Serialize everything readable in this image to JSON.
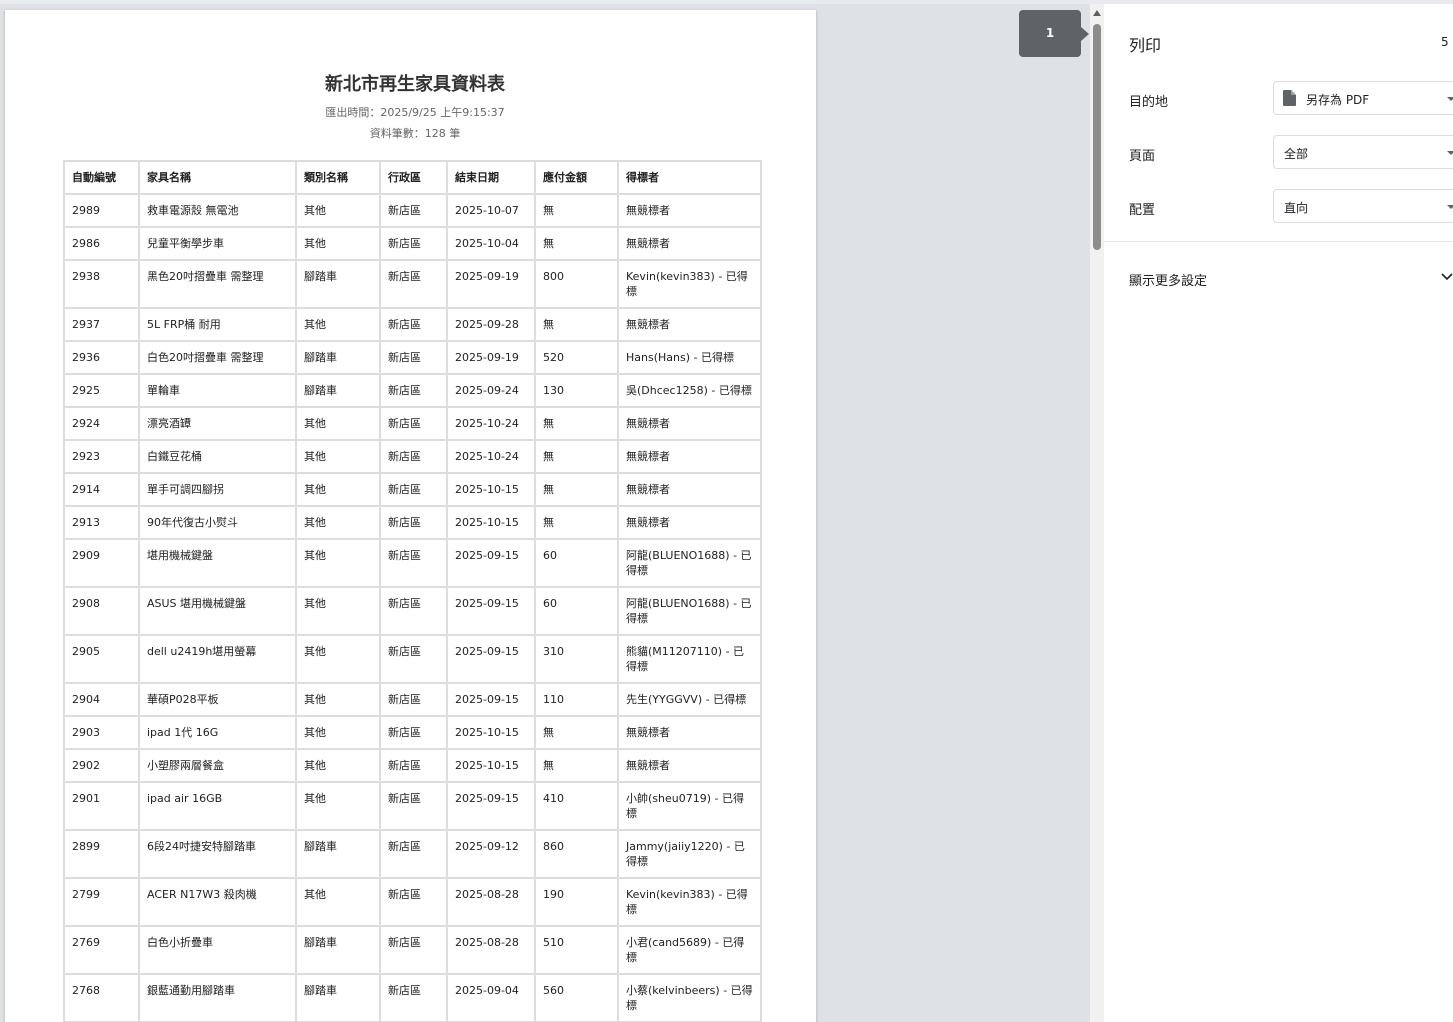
{
  "document": {
    "title": "新北市再生家具資料表",
    "export_time": "匯出時間：2025/9/25 上午9:15:37",
    "record_count": "資料筆數：128 筆"
  },
  "table": {
    "headers": [
      "自動編號",
      "家具名稱",
      "類別名稱",
      "行政區",
      "結束日期",
      "應付金額",
      "得標者"
    ],
    "rows": [
      [
        "2989",
        "救車電源殼 無電池",
        "其他",
        "新店區",
        "2025-10-07",
        "無",
        "無競標者"
      ],
      [
        "2986",
        "兒童平衡學步車",
        "其他",
        "新店區",
        "2025-10-04",
        "無",
        "無競標者"
      ],
      [
        "2938",
        "黑色20吋摺疊車 需整理",
        "腳踏車",
        "新店區",
        "2025-09-19",
        "800",
        "Kevin(kevin383) - 已得標"
      ],
      [
        "2937",
        "5L FRP桶 耐用",
        "其他",
        "新店區",
        "2025-09-28",
        "無",
        "無競標者"
      ],
      [
        "2936",
        "白色20吋摺疊車 需整理",
        "腳踏車",
        "新店區",
        "2025-09-19",
        "520",
        "Hans(Hans) - 已得標"
      ],
      [
        "2925",
        "單輪車",
        "腳踏車",
        "新店區",
        "2025-09-24",
        "130",
        "吳(Dhcec1258) - 已得標"
      ],
      [
        "2924",
        "漂亮酒罈",
        "其他",
        "新店區",
        "2025-10-24",
        "無",
        "無競標者"
      ],
      [
        "2923",
        "白鐵豆花桶",
        "其他",
        "新店區",
        "2025-10-24",
        "無",
        "無競標者"
      ],
      [
        "2914",
        "單手可調四腳拐",
        "其他",
        "新店區",
        "2025-10-15",
        "無",
        "無競標者"
      ],
      [
        "2913",
        "90年代復古小熨斗",
        "其他",
        "新店區",
        "2025-10-15",
        "無",
        "無競標者"
      ],
      [
        "2909",
        "堪用機械鍵盤",
        "其他",
        "新店區",
        "2025-09-15",
        "60",
        "阿龍(BLUENO1688) - 已得標"
      ],
      [
        "2908",
        "ASUS 堪用機械鍵盤",
        "其他",
        "新店區",
        "2025-09-15",
        "60",
        "阿龍(BLUENO1688) - 已得標"
      ],
      [
        "2905",
        "dell u2419h堪用螢幕",
        "其他",
        "新店區",
        "2025-09-15",
        "310",
        "熊貓(M11207110) - 已得標"
      ],
      [
        "2904",
        "華碩P028平板",
        "其他",
        "新店區",
        "2025-09-15",
        "110",
        "先生(YYGGVV) - 已得標"
      ],
      [
        "2903",
        "ipad 1代 16G",
        "其他",
        "新店區",
        "2025-10-15",
        "無",
        "無競標者"
      ],
      [
        "2902",
        "小塑膠兩層餐盒",
        "其他",
        "新店區",
        "2025-10-15",
        "無",
        "無競標者"
      ],
      [
        "2901",
        "ipad air 16GB",
        "其他",
        "新店區",
        "2025-09-15",
        "410",
        "小帥(sheu0719) - 已得標"
      ],
      [
        "2899",
        "6段24吋捷安特腳踏車",
        "腳踏車",
        "新店區",
        "2025-09-12",
        "860",
        "Jammy(jaiiy1220) - 已得標"
      ],
      [
        "2799",
        "ACER N17W3 殺肉機",
        "其他",
        "新店區",
        "2025-08-28",
        "190",
        "Kevin(kevin383) - 已得標"
      ],
      [
        "2769",
        "白色小折疊車",
        "腳踏車",
        "新店區",
        "2025-08-28",
        "510",
        "小君(cand5689) - 已得標"
      ],
      [
        "2768",
        "銀藍通勤用腳踏車",
        "腳踏車",
        "新店區",
        "2025-09-04",
        "560",
        "小蔡(kelvinbeers) - 已得標"
      ]
    ]
  },
  "preview": {
    "page_number": "1"
  },
  "sidebar": {
    "title": "列印",
    "sheet_count": "5",
    "destination_label": "目的地",
    "destination_value": "另存為 PDF",
    "pages_label": "頁面",
    "pages_value": "全部",
    "layout_label": "配置",
    "layout_value": "直向",
    "more_settings": "顯示更多設定"
  },
  "icons": {
    "destination": "document-icon",
    "more": "chevron-down-icon"
  }
}
